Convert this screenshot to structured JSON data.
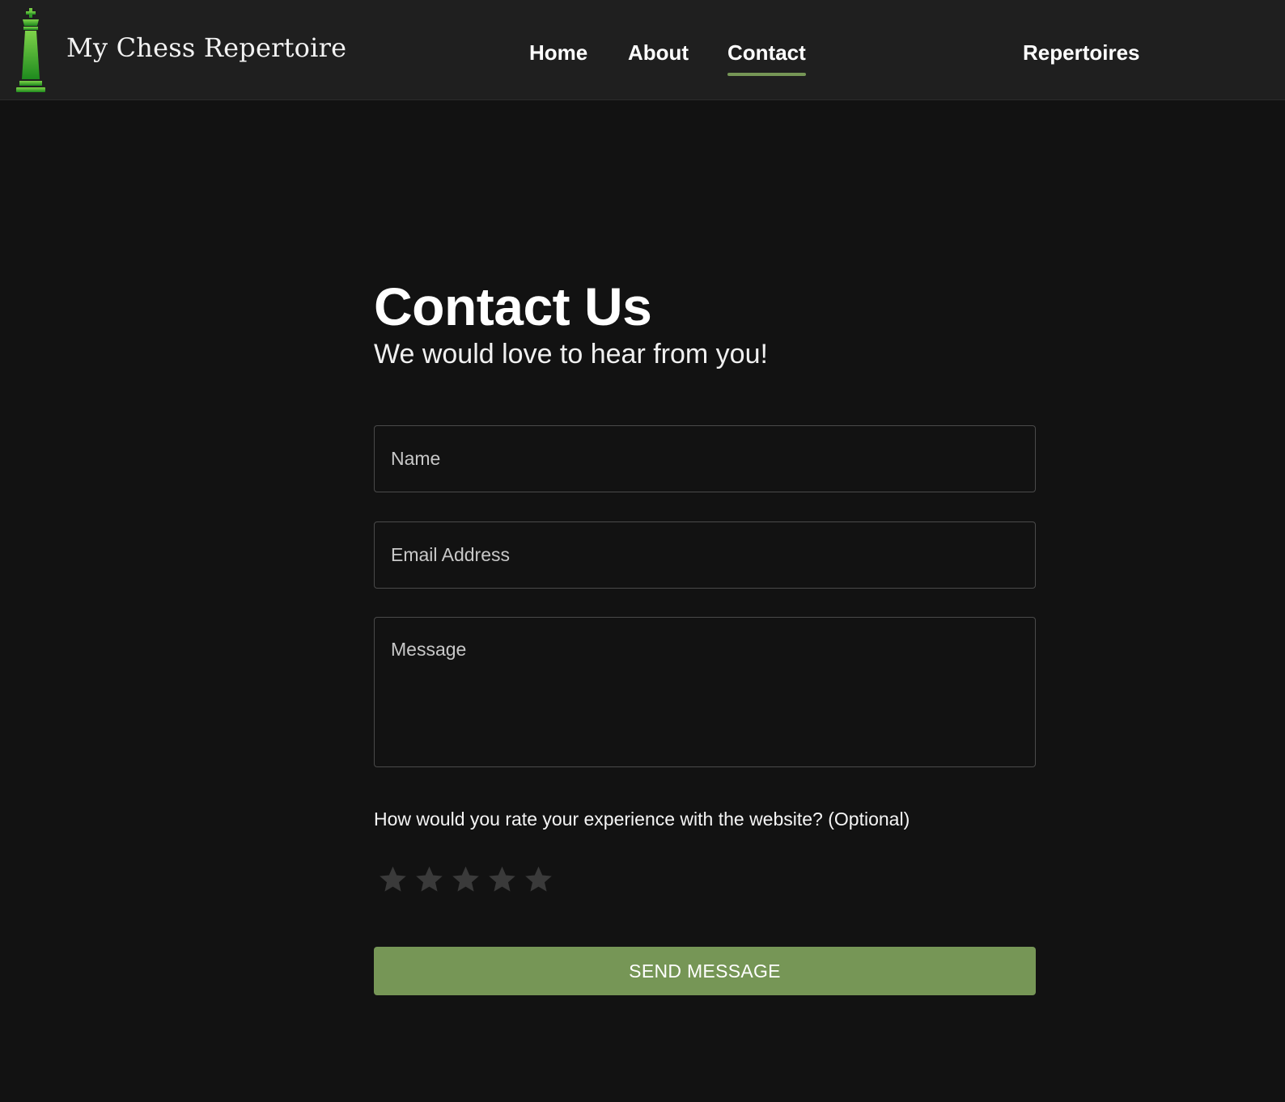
{
  "header": {
    "brand_name": "My Chess Repertoire",
    "logo_icon": "chess-king-icon",
    "nav": {
      "home": "Home",
      "about": "About",
      "contact": "Contact",
      "repertoires": "Repertoires"
    },
    "active_nav": "contact"
  },
  "contact": {
    "title": "Contact Us",
    "subtitle": "We would love to hear from you!",
    "name_placeholder": "Name",
    "email_placeholder": "Email Address",
    "message_placeholder": "Message",
    "rating_question": "How would you rate your experience with the website? (Optional)",
    "rating_value": 0,
    "rating_max": 5,
    "submit_label": "SEND MESSAGE"
  },
  "colors": {
    "page_background": "#121212",
    "navbar_background": "#1f1f1f",
    "accent_green": "#769656",
    "logo_green_light": "#7fd34a",
    "logo_green_dark": "#1e8a1e",
    "star_inactive": "#3a3a3a"
  }
}
